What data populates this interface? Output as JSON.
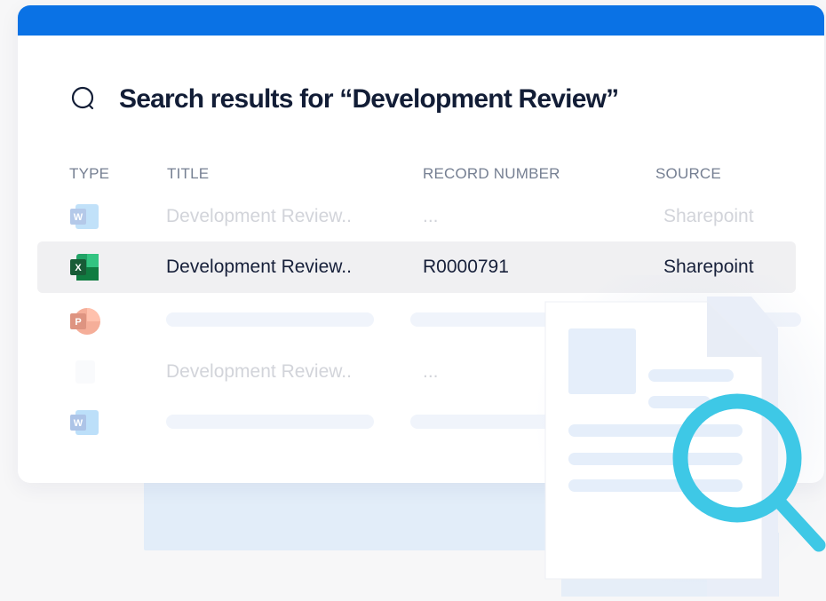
{
  "heading": {
    "text": "Search results for “Development Review”",
    "icon": "search-icon"
  },
  "table": {
    "headers": [
      "TYPE",
      "TITLE",
      "RECORD NUMBER",
      "SOURCE"
    ],
    "rows": [
      {
        "type_icon": "word-file-icon",
        "title": "Development Review..",
        "record": "...",
        "source": "Sharepoint",
        "state": "faded"
      },
      {
        "type_icon": "excel-file-icon",
        "title": "Development Review..",
        "record": "R0000791",
        "source": "Sharepoint",
        "state": "selected"
      },
      {
        "type_icon": "powerpoint-file-icon",
        "title": "",
        "record": "",
        "source": "",
        "state": "placeholder"
      },
      {
        "type_icon": "blank-file-icon",
        "title": "Development Review..",
        "record": "...",
        "source": "",
        "state": "faded"
      },
      {
        "type_icon": "word-file-icon",
        "title": "",
        "record": "",
        "source": "",
        "state": "placeholder"
      }
    ]
  },
  "colors": {
    "topbar": "#0a72e5",
    "heading_text": "#121d36",
    "magnifier": "#3ec8e6",
    "excel_green": "#1f7a43",
    "powerpoint_orange": "#e05a3a",
    "word_blue": "#2b64c8"
  },
  "illustration": {
    "icon": "document-magnifier-icon"
  }
}
